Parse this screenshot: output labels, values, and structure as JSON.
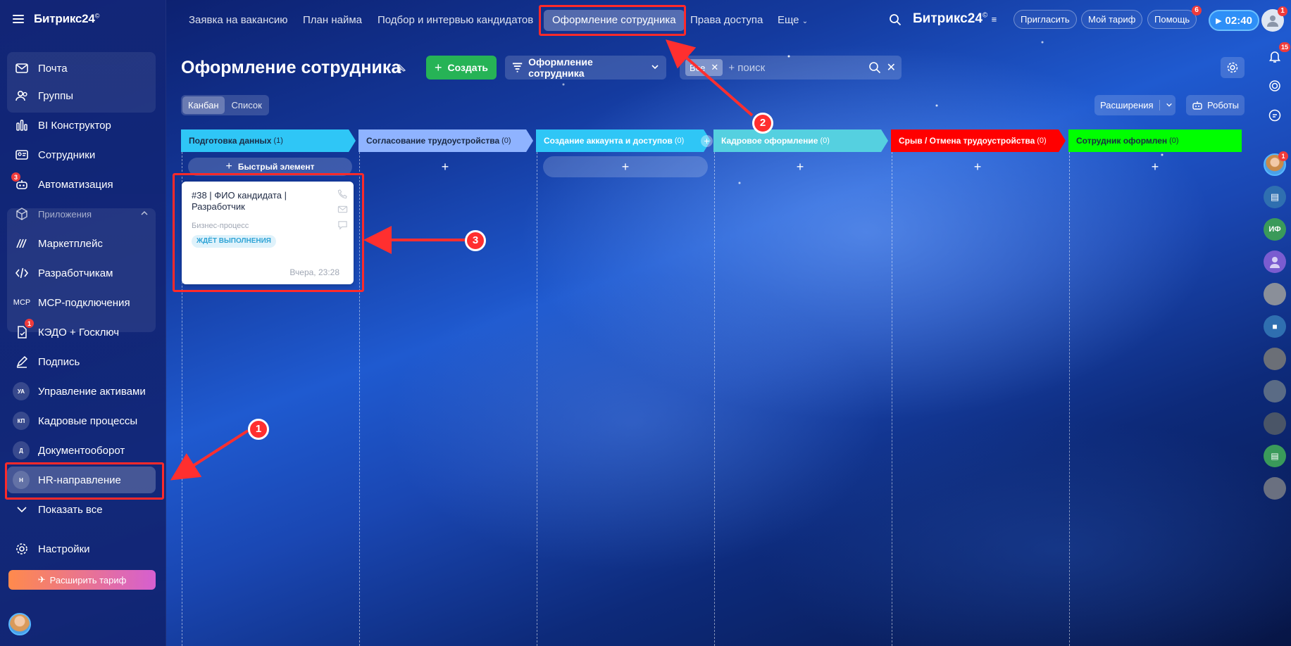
{
  "sidebar": {
    "brand": "Битрикс24",
    "brand_mark": "©",
    "items": [
      {
        "label": "Почта",
        "icon": "mail-icon"
      },
      {
        "label": "Группы",
        "icon": "groups-icon"
      },
      {
        "label": "BI Конструктор",
        "icon": "bi-chart-icon"
      },
      {
        "label": "Сотрудники",
        "icon": "employees-icon"
      },
      {
        "label": "Автоматизация",
        "icon": "automation-icon",
        "badge": "3"
      },
      {
        "label": "Приложения",
        "icon": "apps-cube-icon"
      },
      {
        "label": "Маркетплейс",
        "icon": "marketplace-icon"
      },
      {
        "label": "Разработчикам",
        "icon": "code-icon"
      },
      {
        "label": "MCP-подключения",
        "icon": "mcp-icon",
        "icon_text": "MCP"
      },
      {
        "label": "КЭДО + Госключ",
        "icon": "document-sign-icon",
        "badge": "1"
      },
      {
        "label": "Подпись",
        "icon": "signature-pen-icon"
      },
      {
        "label": "Управление активами",
        "icon_text": "УА"
      },
      {
        "label": "Кадровые процессы",
        "icon_text": "КП"
      },
      {
        "label": "Документооборот",
        "icon_text": "Д"
      },
      {
        "label": "HR-направление",
        "icon_text": "H"
      },
      {
        "label": "Показать все",
        "icon": "chevron-down-icon"
      },
      {
        "label": "Настройки",
        "icon": "gear-icon"
      }
    ],
    "upgrade_label": "Расширить тариф"
  },
  "topbar": {
    "tabs": [
      {
        "label": "Заявка на вакансию"
      },
      {
        "label": "План найма"
      },
      {
        "label": "Подбор и интервью кандидатов"
      },
      {
        "label": "Оформление сотрудника",
        "active": true
      },
      {
        "label": "Права доступа"
      },
      {
        "label": "Еще"
      }
    ],
    "brand": "Битрикс",
    "brand_num": "24",
    "brand_mark": "©",
    "invite_label": "Пригласить",
    "tariff_label": "Мой тариф",
    "help_label": "Помощь",
    "help_badge": "6",
    "timer": "02:40",
    "avatar_badge": "1"
  },
  "page": {
    "title": "Оформление сотрудника",
    "create_label": "Создать",
    "funnel_label": "Оформление сотрудника",
    "filter_chip": "Все",
    "search_placeholder": "+ поиск",
    "view_kanban": "Канбан",
    "view_list": "Список",
    "extensions_label": "Расширения",
    "robots_label": "Роботы"
  },
  "kanban": {
    "columns": [
      {
        "title": "Подготовка данных",
        "count": "(1)",
        "color": "#2fc6f6",
        "text_color": "#1b2a44"
      },
      {
        "title": "Согласование трудоустройства",
        "count": "(0)",
        "color": "#8fb3ff",
        "text_color": "#1b2a44"
      },
      {
        "title": "Создание аккаунта и доступов",
        "count": "(0)",
        "color": "#2fc6f6",
        "text_color": "#ffffff"
      },
      {
        "title": "Кадровое оформление",
        "count": "(0)",
        "color": "#55d0e0",
        "text_color": "#ffffff"
      },
      {
        "title": "Срыв / Отмена трудоустройства",
        "count": "(0)",
        "color": "#ff0000",
        "text_color": "#ffffff"
      },
      {
        "title": "Сотрудник оформлен",
        "count": "(0)",
        "color": "#00ff00",
        "text_color": "#1b2a44"
      }
    ],
    "quick_add_label": "Быстрый элемент",
    "add_symbol": "+",
    "card": {
      "title": "#38 | ФИО кандидата | Разработчик",
      "subtitle": "Бизнес-процесс",
      "status": "ЖДЁТ ВЫПОЛНЕНИЯ",
      "date": "Вчера, 23:28"
    }
  },
  "rail": {
    "notifications_badge": "15",
    "user_badge": "1",
    "contact_initials": "ИФ"
  },
  "annotations": {
    "marker_1": "1",
    "marker_2": "2",
    "marker_3": "3"
  },
  "colors": {
    "accent_create": "#26b356",
    "highlight": "#ff2a2a",
    "timer": "#2e8ff7"
  }
}
